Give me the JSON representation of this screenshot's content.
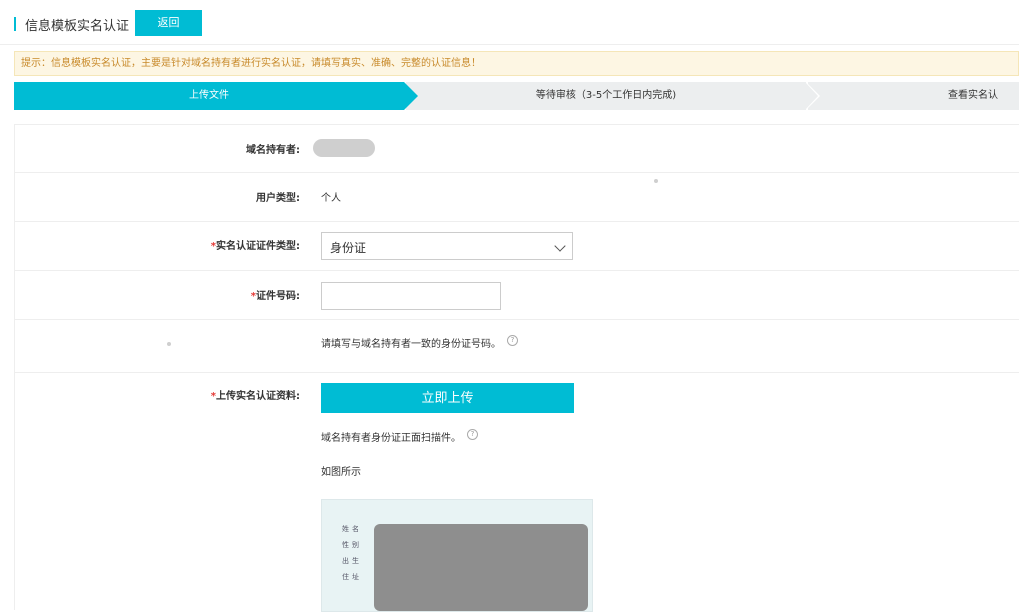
{
  "header": {
    "title": "信息模板实名认证",
    "back_label": "返回"
  },
  "notice": "提示：信息模板实名认证，主要是针对域名持有者进行实名认证，请填写真实、准确、完整的认证信息！",
  "steps": [
    {
      "label": "上传文件",
      "active": true
    },
    {
      "label": "等待审核（3-5个工作日内完成)",
      "active": false
    },
    {
      "label": "查看实名认",
      "active": false
    }
  ],
  "form": {
    "holder_label": "域名持有者:",
    "user_type_label": "用户类型:",
    "user_type_value": "个人",
    "required_mark": "*",
    "id_type_label": "实名认证证件类型:",
    "id_type_value": "身份证",
    "id_number_label": "证件号码:",
    "id_number_value": "",
    "id_hint": "请填写与域名持有者一致的身份证号码。",
    "upload_label": "上传实名认证资料:",
    "upload_button": "立即上传",
    "upload_hint": "域名持有者身份证正面扫描件。",
    "example_caption": "如图所示",
    "help_glyph": "?",
    "card_fields": [
      "姓名",
      "性别",
      "出生",
      "住址"
    ]
  },
  "colors": {
    "accent": "#00bcd4",
    "notice_text": "#c88a2b",
    "notice_bg": "#fdf6e3",
    "required": "#e53935"
  }
}
